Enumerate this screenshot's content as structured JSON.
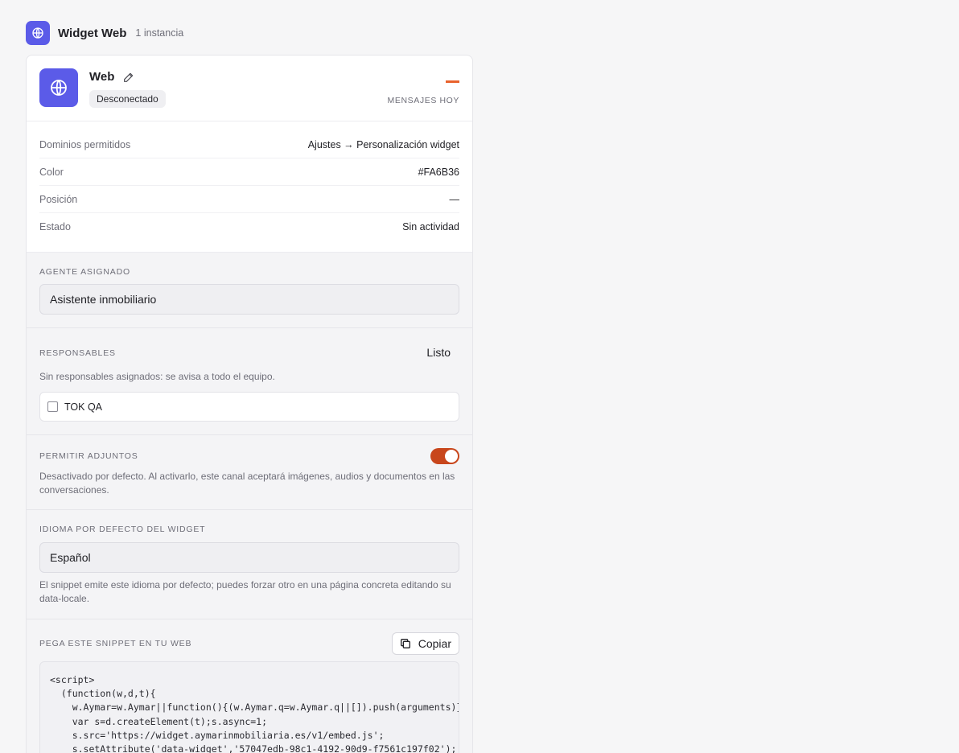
{
  "section": {
    "icon": "globe-icon",
    "title": "Widget Web",
    "count": "1 instancia"
  },
  "channel": {
    "icon": "globe-icon",
    "name": "Web",
    "edit_icon": "pencil-icon",
    "status": "Desconectado",
    "messages_label": "Mensajes hoy",
    "messages_value": "—",
    "accent_color": "#e8622c"
  },
  "details": [
    {
      "label": "Dominios permitidos",
      "value": "Ajustes → Personalización widget"
    },
    {
      "label": "Color",
      "value": "#FA6B36"
    },
    {
      "label": "Posición",
      "value": "—"
    },
    {
      "label": "Estado",
      "value": "Sin actividad"
    }
  ],
  "agent": {
    "label": "Agente asignado",
    "selected": "Asistente inmobiliario"
  },
  "responsables": {
    "label": "Responsables",
    "done_label": "Listo",
    "helper": "Sin responsables asignados: se avisa a todo el equipo.",
    "members": [
      {
        "name": "TOK QA",
        "checked": false
      }
    ]
  },
  "attachments": {
    "label": "Permitir adjuntos",
    "enabled": true,
    "helper": "Desactivado por defecto. Al activarlo, este canal aceptará imágenes, audios y documentos en las conversaciones."
  },
  "language": {
    "label": "Idioma por defecto del widget",
    "selected": "Español",
    "helper": "El snippet emite este idioma por defecto; puedes forzar otro en una página concreta editando su data-locale."
  },
  "snippet": {
    "label": "Pega este snippet en tu web",
    "copy_label": "Copiar",
    "copy_icon": "copy-icon",
    "lines": [
      "<script>",
      "  (function(w,d,t){",
      "    w.Aymar=w.Aymar||function(){(w.Aymar.q=w.Aymar.q||[]).push(arguments)};",
      "    var s=d.createElement(t);s.async=1;",
      "    s.src='https://widget.aymarinmobiliaria.es/v1/embed.js';",
      "    s.setAttribute('data-widget','57047edb-98c1-4192-90d9-f7561c197f02');"
    ]
  }
}
